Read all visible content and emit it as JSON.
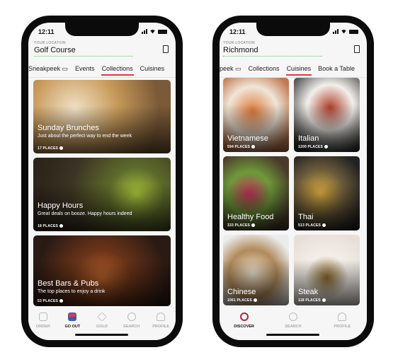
{
  "left": {
    "status_time": "12:11",
    "location_label": "YOUR LOCATION",
    "location": "Golf Course",
    "tabs": [
      {
        "label": "Sneakpeek ▭"
      },
      {
        "label": "Events"
      },
      {
        "label": "Collections",
        "active": true
      },
      {
        "label": "Cuisines"
      }
    ],
    "cards": [
      {
        "title": "Sunday Brunches",
        "subtitle": "Just about the perfect way to end the week",
        "places": "17 PLACES"
      },
      {
        "title": "Happy Hours",
        "subtitle": "Great deals on booze. Happy hours indeed",
        "places": "18 PLACES"
      },
      {
        "title": "Best Bars & Pubs",
        "subtitle": "The top places to enjoy a drink",
        "places": "53 PLACES"
      }
    ],
    "nav": [
      {
        "label": "ORDER",
        "icon": "order-icon"
      },
      {
        "label": "GO OUT",
        "icon": "store-icon",
        "active": true
      },
      {
        "label": "GOLD",
        "icon": "gold-icon"
      },
      {
        "label": "SEARCH",
        "icon": "search-icon"
      },
      {
        "label": "PROFILE",
        "icon": "profile-icon"
      }
    ]
  },
  "right": {
    "status_time": "12:11",
    "location_label": "YOUR LOCATION",
    "location": "Richmond",
    "tabs": [
      {
        "label": "peek ▭"
      },
      {
        "label": "Collections"
      },
      {
        "label": "Cuisines",
        "active": true
      },
      {
        "label": "Book a Table"
      }
    ],
    "cards": [
      {
        "title": "Vietnamese",
        "places": "594 PLACES"
      },
      {
        "title": "Italian",
        "places": "1200 PLACES"
      },
      {
        "title": "Healthy Food",
        "places": "333 PLACES"
      },
      {
        "title": "Thai",
        "places": "513 PLACES"
      },
      {
        "title": "Chinese",
        "places": "1061 PLACES"
      },
      {
        "title": "Steak",
        "places": "118 PLACES"
      }
    ],
    "nav": [
      {
        "label": "DISCOVER",
        "icon": "compass-icon",
        "active": true
      },
      {
        "label": "SEARCH",
        "icon": "search-icon"
      },
      {
        "label": "PROFILE",
        "icon": "profile-icon"
      }
    ]
  },
  "colors": {
    "accent": "#e23744"
  }
}
